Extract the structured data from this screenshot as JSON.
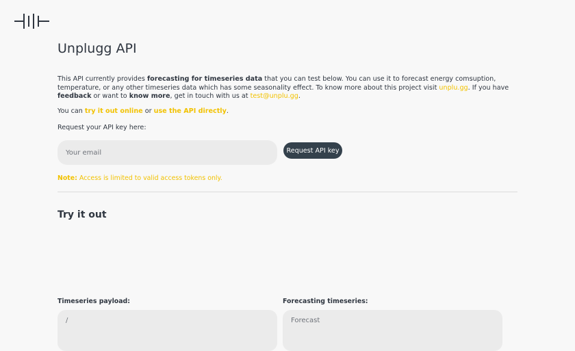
{
  "logo": {
    "icon": "unplugg-logo"
  },
  "page": {
    "title": "Unplugg API"
  },
  "intro": {
    "t1": "This API currently provides ",
    "b1": "forecasting for timeseries data",
    "t2": " that you can test below. You can use it to forecast energy comsuption, temperature, or any other timeseries data which has some seasonality effect. To know more about this project visit ",
    "link_site": "unplu.gg",
    "t3": ". If you have ",
    "b2": "feedback",
    "t4": " or want to ",
    "b3": "know more",
    "t5": ", get in touch with us at ",
    "link_email": "test@unplu.gg",
    "t6": "."
  },
  "usage": {
    "t1": "You can ",
    "link_online": "try it out online",
    "t2": " or ",
    "link_api": "use the API directly",
    "t3": "."
  },
  "request": {
    "label": "Request your API key here:",
    "email_placeholder": "Your email",
    "button_label": "Request API key"
  },
  "note": {
    "prefix": "Note:",
    "text": " Access is limited to valid access tokens only."
  },
  "try_it": {
    "heading": "Try it out",
    "payload_label": "Timeseries payload:",
    "payload_placeholder": "/",
    "forecast_label": "Forecasting timeseries:",
    "forecast_placeholder": "Forecast"
  },
  "colors": {
    "accent": "#f2c200",
    "button_bg": "#34414c",
    "text": "#2f3640",
    "input_bg": "#ebebeb",
    "page_bg": "#f8f8f8"
  }
}
